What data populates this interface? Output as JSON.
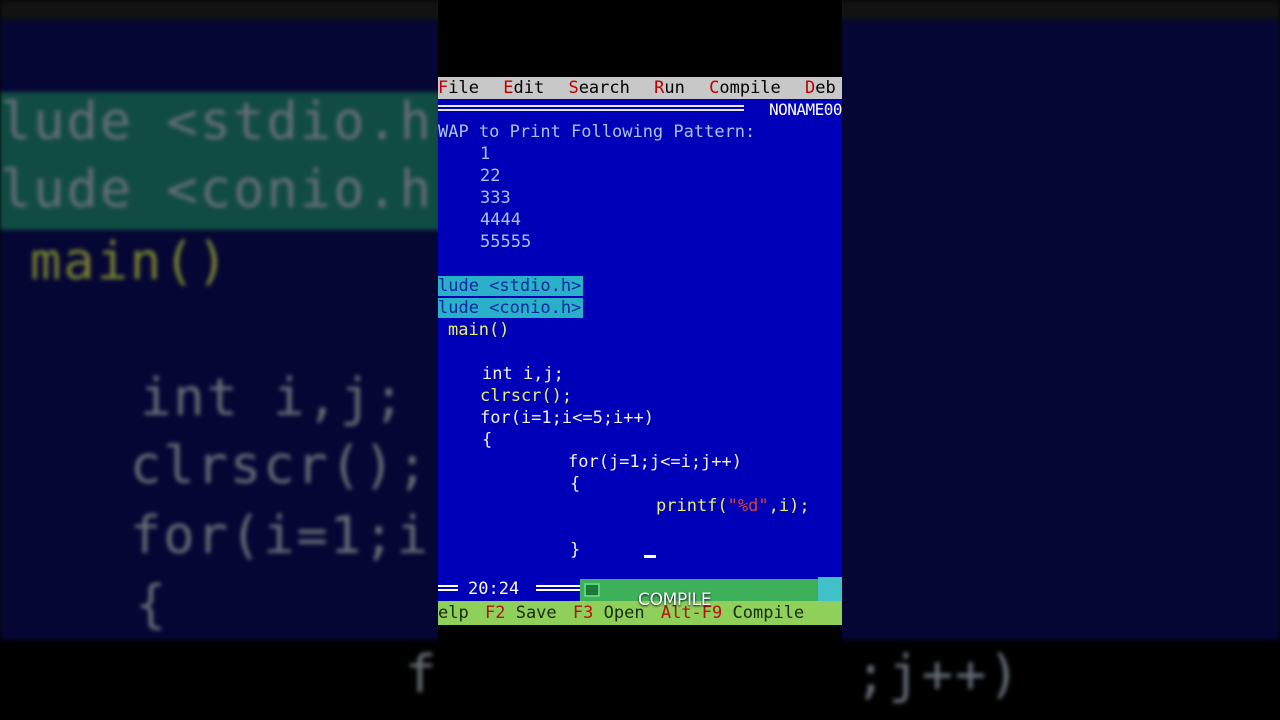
{
  "menu": {
    "items": [
      {
        "hot": "F",
        "rest": "ile"
      },
      {
        "hot": "E",
        "rest": "dit"
      },
      {
        "hot": "S",
        "rest": "earch"
      },
      {
        "hot": "R",
        "rest": "un"
      },
      {
        "hot": "C",
        "rest": "ompile"
      },
      {
        "hot": "D",
        "rest": "eb"
      }
    ]
  },
  "editor": {
    "filename": "NONAME00",
    "comment": "WAP to Print Following Pattern:",
    "pattern": [
      "1",
      "22",
      "333",
      "4444",
      "55555"
    ],
    "include1": "lude <stdio.h>",
    "include2": "lude <conio.h>",
    "main": "main()",
    "decl": "int i,j;",
    "clrscr": "clrscr();",
    "for_outer": "for(i=1;i<=5;i++)",
    "brace_open_outer": "{",
    "for_inner": "for(j=1;j<=i;j++)",
    "brace_open_inner": "{",
    "printf_pre": "printf(",
    "printf_str": "\"%d\"",
    "printf_post": ",i);",
    "brace_close_inner": "}"
  },
  "status": {
    "time": "20:24"
  },
  "helpbar": {
    "items": [
      {
        "key": "",
        "label": "elp"
      },
      {
        "key": "F2",
        "label": "Save"
      },
      {
        "key": "F3",
        "label": "Open"
      },
      {
        "key": "Alt-F9",
        "label": "Compile"
      }
    ]
  },
  "overlay_caption": "COMPILE",
  "background": {
    "lines": [
      "lude <stdio.h",
      "lude <conio.h",
      "main()",
      "int i,j;",
      "clrscr();",
      "for(i=1;i",
      "{",
      "f",
      ";j++)"
    ]
  },
  "colors": {
    "editor_bg": "#0000b8",
    "menu_bg": "#c8c8c8",
    "hotkey": "#c00000",
    "selection": "#2ab0c8",
    "helpbar_bg": "#8fd05a"
  }
}
